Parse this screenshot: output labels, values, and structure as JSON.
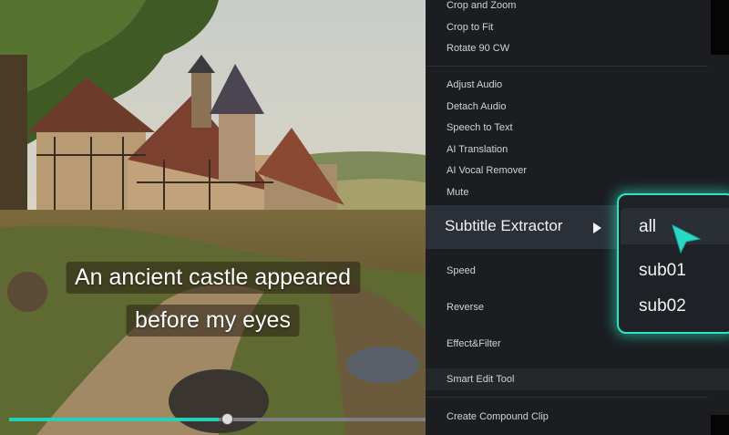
{
  "subtitle": {
    "line1": "An ancient castle appeared",
    "line2": "before my eyes"
  },
  "playback": {
    "progress": 0.5
  },
  "menu": {
    "items_top": [
      "Crop and Zoom",
      "Crop to Fit",
      "Rotate 90 CW"
    ],
    "items_audio": [
      "Adjust Audio",
      "Detach Audio",
      "Speech to Text",
      "AI Translation",
      "AI Vocal Remover",
      "Mute"
    ],
    "subtitle_extractor": "Subtitle Extractor",
    "speed": "Speed",
    "reverse": "Reverse",
    "effect_filter": "Effect&Filter",
    "smart_edit_tool": "Smart Edit Tool",
    "create_compound_clip": "Create Compound Clip"
  },
  "submenu": {
    "options": [
      "all",
      "sub01",
      "sub02"
    ],
    "selected": "all"
  },
  "colors": {
    "accent": "#2fe3c7",
    "menu_bg": "#1b1d21",
    "progress": "#25d1b6"
  },
  "icons": {
    "submenu_arrow": "chevron-right-icon",
    "pointer": "cursor-arrow-icon"
  }
}
